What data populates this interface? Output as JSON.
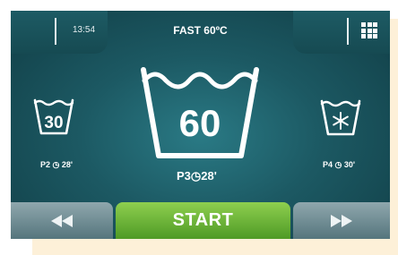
{
  "header": {
    "time": "13:54",
    "program_title": "FAST 60ºC",
    "menu_icon": "grid-menu-icon"
  },
  "programs": {
    "left": {
      "tub_value": "30",
      "label": "P2   28'",
      "code": "P2",
      "duration": "28'"
    },
    "center": {
      "tub_value": "60",
      "code": "P3",
      "duration": "28'"
    },
    "right": {
      "tub_icon": "snowflake-icon",
      "code": "P4",
      "duration": "30'"
    }
  },
  "footer": {
    "prev_icon": "rewind-icon",
    "start_label": "START",
    "next_icon": "fast-forward-icon"
  },
  "colors": {
    "screen_bg": "#1c5963",
    "start_green": "#6fb43a",
    "nav_gray": "#7591 98"
  }
}
